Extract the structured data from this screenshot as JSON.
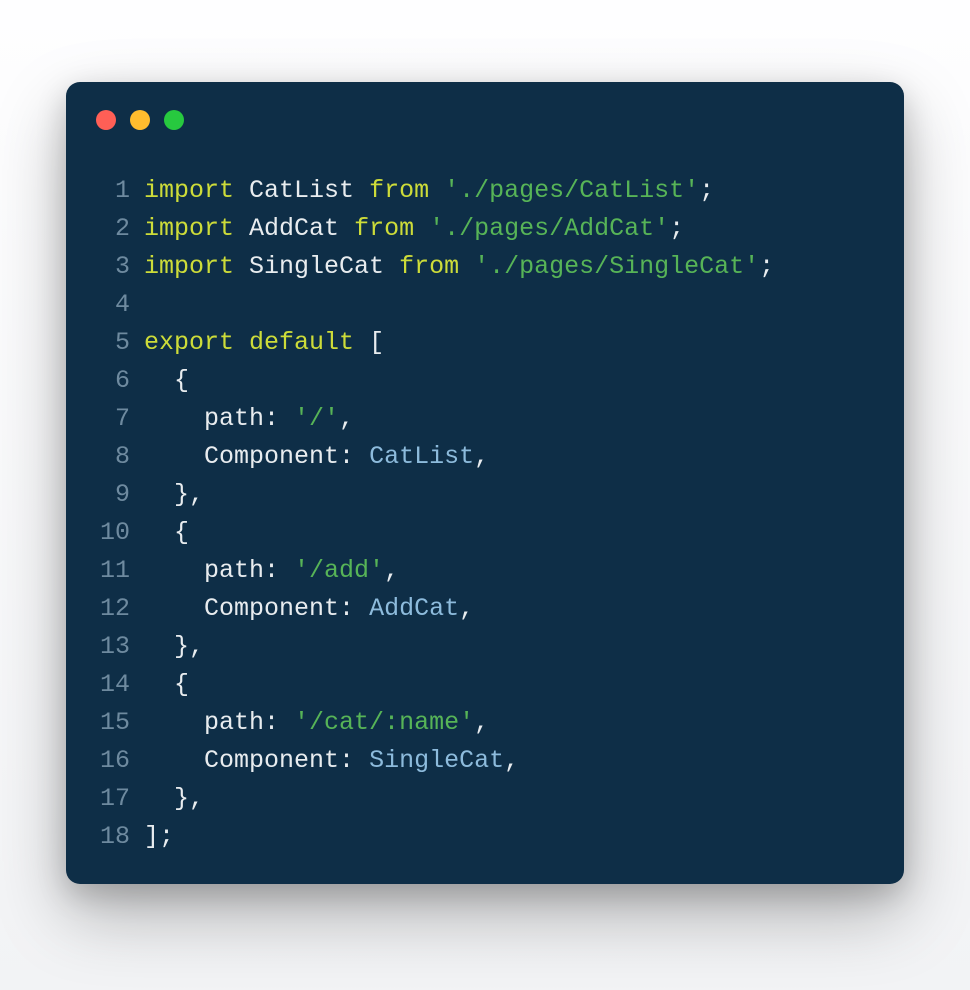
{
  "traffic_lights": [
    "red",
    "yellow",
    "green"
  ],
  "lines": [
    {
      "n": "1",
      "tokens": [
        {
          "c": "kw",
          "t": "import"
        },
        {
          "c": "punc",
          "t": " "
        },
        {
          "c": "ident",
          "t": "CatList"
        },
        {
          "c": "punc",
          "t": " "
        },
        {
          "c": "kw",
          "t": "from"
        },
        {
          "c": "punc",
          "t": " "
        },
        {
          "c": "str",
          "t": "'./pages/CatList'"
        },
        {
          "c": "punc",
          "t": ";"
        }
      ]
    },
    {
      "n": "2",
      "tokens": [
        {
          "c": "kw",
          "t": "import"
        },
        {
          "c": "punc",
          "t": " "
        },
        {
          "c": "ident",
          "t": "AddCat"
        },
        {
          "c": "punc",
          "t": " "
        },
        {
          "c": "kw",
          "t": "from"
        },
        {
          "c": "punc",
          "t": " "
        },
        {
          "c": "str",
          "t": "'./pages/AddCat'"
        },
        {
          "c": "punc",
          "t": ";"
        }
      ]
    },
    {
      "n": "3",
      "tokens": [
        {
          "c": "kw",
          "t": "import"
        },
        {
          "c": "punc",
          "t": " "
        },
        {
          "c": "ident",
          "t": "SingleCat"
        },
        {
          "c": "punc",
          "t": " "
        },
        {
          "c": "kw",
          "t": "from"
        },
        {
          "c": "punc",
          "t": " "
        },
        {
          "c": "str",
          "t": "'./pages/SingleCat'"
        },
        {
          "c": "punc",
          "t": ";"
        }
      ]
    },
    {
      "n": "4",
      "tokens": []
    },
    {
      "n": "5",
      "tokens": [
        {
          "c": "kw",
          "t": "export"
        },
        {
          "c": "punc",
          "t": " "
        },
        {
          "c": "kw",
          "t": "default"
        },
        {
          "c": "punc",
          "t": " ["
        }
      ]
    },
    {
      "n": "6",
      "tokens": [
        {
          "c": "punc",
          "t": "  {"
        }
      ]
    },
    {
      "n": "7",
      "tokens": [
        {
          "c": "punc",
          "t": "    "
        },
        {
          "c": "prop",
          "t": "path"
        },
        {
          "c": "punc",
          "t": ": "
        },
        {
          "c": "str",
          "t": "'/'"
        },
        {
          "c": "punc",
          "t": ","
        }
      ]
    },
    {
      "n": "8",
      "tokens": [
        {
          "c": "punc",
          "t": "    "
        },
        {
          "c": "prop",
          "t": "Component"
        },
        {
          "c": "punc",
          "t": ": "
        },
        {
          "c": "cls",
          "t": "CatList"
        },
        {
          "c": "punc",
          "t": ","
        }
      ]
    },
    {
      "n": "9",
      "tokens": [
        {
          "c": "punc",
          "t": "  },"
        }
      ]
    },
    {
      "n": "10",
      "tokens": [
        {
          "c": "punc",
          "t": "  {"
        }
      ]
    },
    {
      "n": "11",
      "tokens": [
        {
          "c": "punc",
          "t": "    "
        },
        {
          "c": "prop",
          "t": "path"
        },
        {
          "c": "punc",
          "t": ": "
        },
        {
          "c": "str",
          "t": "'/add'"
        },
        {
          "c": "punc",
          "t": ","
        }
      ]
    },
    {
      "n": "12",
      "tokens": [
        {
          "c": "punc",
          "t": "    "
        },
        {
          "c": "prop",
          "t": "Component"
        },
        {
          "c": "punc",
          "t": ": "
        },
        {
          "c": "cls",
          "t": "AddCat"
        },
        {
          "c": "punc",
          "t": ","
        }
      ]
    },
    {
      "n": "13",
      "tokens": [
        {
          "c": "punc",
          "t": "  },"
        }
      ]
    },
    {
      "n": "14",
      "tokens": [
        {
          "c": "punc",
          "t": "  {"
        }
      ]
    },
    {
      "n": "15",
      "tokens": [
        {
          "c": "punc",
          "t": "    "
        },
        {
          "c": "prop",
          "t": "path"
        },
        {
          "c": "punc",
          "t": ": "
        },
        {
          "c": "str",
          "t": "'/cat/:name'"
        },
        {
          "c": "punc",
          "t": ","
        }
      ]
    },
    {
      "n": "16",
      "tokens": [
        {
          "c": "punc",
          "t": "    "
        },
        {
          "c": "prop",
          "t": "Component"
        },
        {
          "c": "punc",
          "t": ": "
        },
        {
          "c": "cls",
          "t": "SingleCat"
        },
        {
          "c": "punc",
          "t": ","
        }
      ]
    },
    {
      "n": "17",
      "tokens": [
        {
          "c": "punc",
          "t": "  },"
        }
      ]
    },
    {
      "n": "18",
      "tokens": [
        {
          "c": "punc",
          "t": "];"
        }
      ]
    }
  ]
}
